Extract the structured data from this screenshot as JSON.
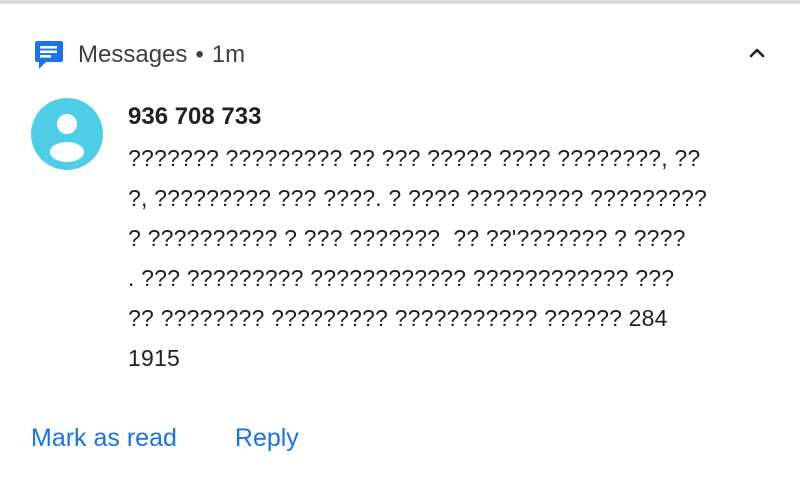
{
  "notification": {
    "app_name": "Messages",
    "separator": "•",
    "time": "1m",
    "sender": "936 708 733",
    "message_lines": [
      "??????? ????????? ?? ??? ????? ???? ????????, ??",
      "?, ????????? ??? ????. ? ???? ????????? ?????????",
      "? ?????????? ? ??? ???????  ?? ??'??????? ? ????",
      ". ??? ????????? ???????????? ???????????? ???",
      "?? ???????? ????????? ??????????? ?????? 284",
      "1915"
    ],
    "actions": {
      "mark_as_read": "Mark as read",
      "reply": "Reply"
    },
    "icons": {
      "app": "messages-app-icon",
      "collapse": "chevron-up-icon",
      "avatar": "person-avatar-icon"
    },
    "colors": {
      "accent": "#1a73e8",
      "avatar_bg": "#4ecde6",
      "app_icon": "#1a73e8"
    }
  }
}
